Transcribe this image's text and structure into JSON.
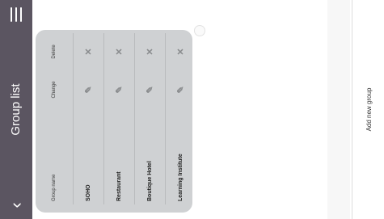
{
  "header": {
    "title": "Group list",
    "back_icon": "chevron-left-icon",
    "menu_icon": "hamburger-menu-icon"
  },
  "table": {
    "columns": {
      "name": "Group name",
      "change": "Change",
      "delete": "Delete"
    },
    "rows": [
      {
        "name": "SOHO"
      },
      {
        "name": "Restaurant"
      },
      {
        "name": "Boutique Hotel"
      },
      {
        "name": "Learning Institute"
      }
    ]
  },
  "footer": {
    "add_label": "Add new group"
  },
  "colors": {
    "titlebar": "#5b5561",
    "panel": "#cfd1d3"
  }
}
